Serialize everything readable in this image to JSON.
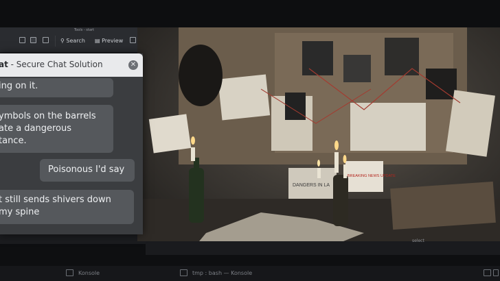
{
  "window": {
    "title": "Tools - start"
  },
  "toolbar": {
    "search_label": "Search",
    "preview_label": "Preview"
  },
  "image_viewer": {
    "scene": "investigation-board",
    "newspaper_text": "DANGERS IN LA",
    "news_badge": "BREAKING NEWS UPDATE",
    "status_tag": "select"
  },
  "chat": {
    "title_bold": "at",
    "title_rest": " - Secure Chat Solution",
    "messages": [
      {
        "from": "other",
        "lines": [
          "ing on it."
        ]
      },
      {
        "from": "other",
        "lines": [
          "ymbols on the barrels",
          "ate a dangerous",
          "tance."
        ]
      },
      {
        "from": "me",
        "lines": [
          "Poisonous I'd say"
        ]
      },
      {
        "from": "other",
        "lines": [
          "t still sends shivers down",
          "my spine"
        ]
      }
    ]
  },
  "taskbar": {
    "items": [
      {
        "label": "Konsole"
      },
      {
        "label": "tmp : bash — Konsole"
      }
    ]
  },
  "colors": {
    "chat_bg": "#3b3d40",
    "bubble": "#55585c",
    "title_bg": "#e9eaec"
  }
}
